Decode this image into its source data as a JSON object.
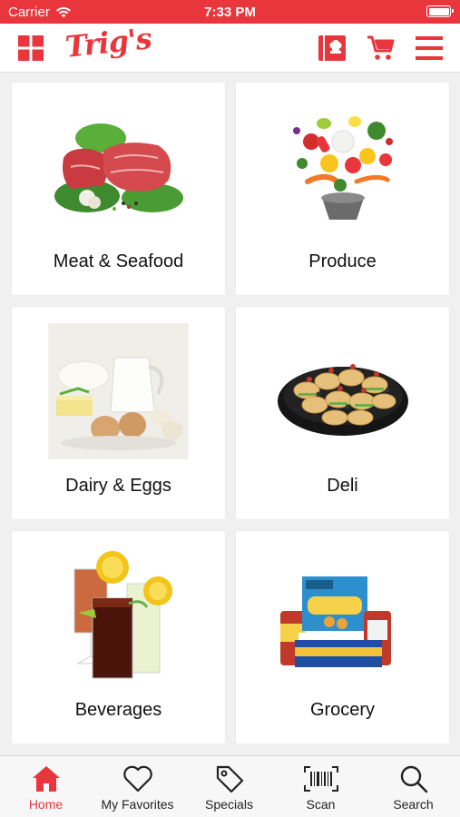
{
  "status_bar": {
    "carrier": "Carrier",
    "time": "7:33 PM"
  },
  "header": {
    "logo_text": "Trig's"
  },
  "categories": [
    {
      "label": "Meat & Seafood",
      "icon": "meat-seafood-image"
    },
    {
      "label": "Produce",
      "icon": "produce-image"
    },
    {
      "label": "Dairy & Eggs",
      "icon": "dairy-eggs-image"
    },
    {
      "label": "Deli",
      "icon": "deli-image"
    },
    {
      "label": "Beverages",
      "icon": "beverages-image"
    },
    {
      "label": "Grocery",
      "icon": "grocery-image"
    }
  ],
  "tabs": [
    {
      "label": "Home",
      "icon": "home-icon",
      "active": true
    },
    {
      "label": "My Favorites",
      "icon": "heart-icon",
      "active": false
    },
    {
      "label": "Specials",
      "icon": "tag-icon",
      "active": false
    },
    {
      "label": "Scan",
      "icon": "barcode-icon",
      "active": false
    },
    {
      "label": "Search",
      "icon": "magnifier-icon",
      "active": false
    }
  ],
  "colors": {
    "brand_red": "#e8363c",
    "tile_bg": "#ffffff",
    "page_bg": "#f0f0f0"
  }
}
